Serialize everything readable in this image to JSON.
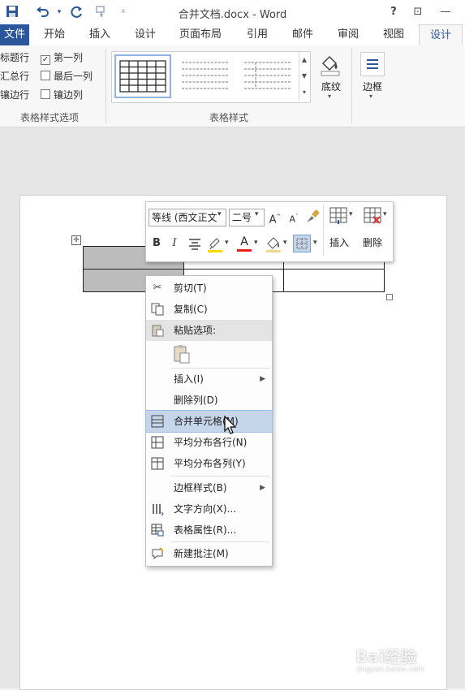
{
  "window": {
    "title": "合并文档.docx - Word",
    "help": "?",
    "restore_ribbon": "⊡",
    "minimize": "—"
  },
  "tabs": [
    "文件",
    "开始",
    "插入",
    "设计",
    "页面布局",
    "引用",
    "邮件",
    "审阅",
    "视图",
    "设计"
  ],
  "ribbon": {
    "style_options": {
      "col1": [
        "标题行",
        "汇总行",
        "镶边行"
      ],
      "col2": [
        "第一列",
        "最后一列",
        "镶边列"
      ],
      "col2_checked": [
        true,
        false,
        false
      ],
      "label": "表格样式选项"
    },
    "styles_label": "表格样式",
    "shading_label": "底纹",
    "borders_label": "边框"
  },
  "minibar": {
    "font": "等线 (西文正文",
    "size": "二号",
    "bold": "B",
    "italic": "I",
    "font_color_letter": "A",
    "grow": "A",
    "shrink": "A",
    "insert_label": "插入",
    "delete_label": "删除"
  },
  "context_menu": {
    "items": [
      {
        "label": "剪切(T)",
        "icon": "scissors-icon"
      },
      {
        "label": "复制(C)",
        "icon": "copy-icon"
      },
      {
        "label": "粘贴选项:",
        "icon": "paste-icon"
      },
      {
        "label": "插入(I)",
        "icon": ""
      },
      {
        "label": "删除列(D)",
        "icon": ""
      },
      {
        "label": "合并单元格(M)",
        "icon": "merge-cells-icon"
      },
      {
        "label": "平均分布各行(N)",
        "icon": "distribute-rows-icon"
      },
      {
        "label": "平均分布各列(Y)",
        "icon": "distribute-columns-icon"
      },
      {
        "label": "边框样式(B)",
        "icon": ""
      },
      {
        "label": "文字方向(X)...",
        "icon": "text-direction-icon"
      },
      {
        "label": "表格属性(R)...",
        "icon": "table-properties-icon"
      },
      {
        "label": "新建批注(M)",
        "icon": "new-comment-icon"
      }
    ],
    "highlighted": "合并单元格(M)"
  },
  "watermark": {
    "brand": "Bai经验",
    "url": "jingyan.baidu.com"
  },
  "colors": {
    "accent": "#2b579a",
    "highlight_bar": "#ffd800",
    "font_color_bar": "#e8201a",
    "selected_cell": "#bcbcbc",
    "menu_hover": "#c5d6ea"
  }
}
